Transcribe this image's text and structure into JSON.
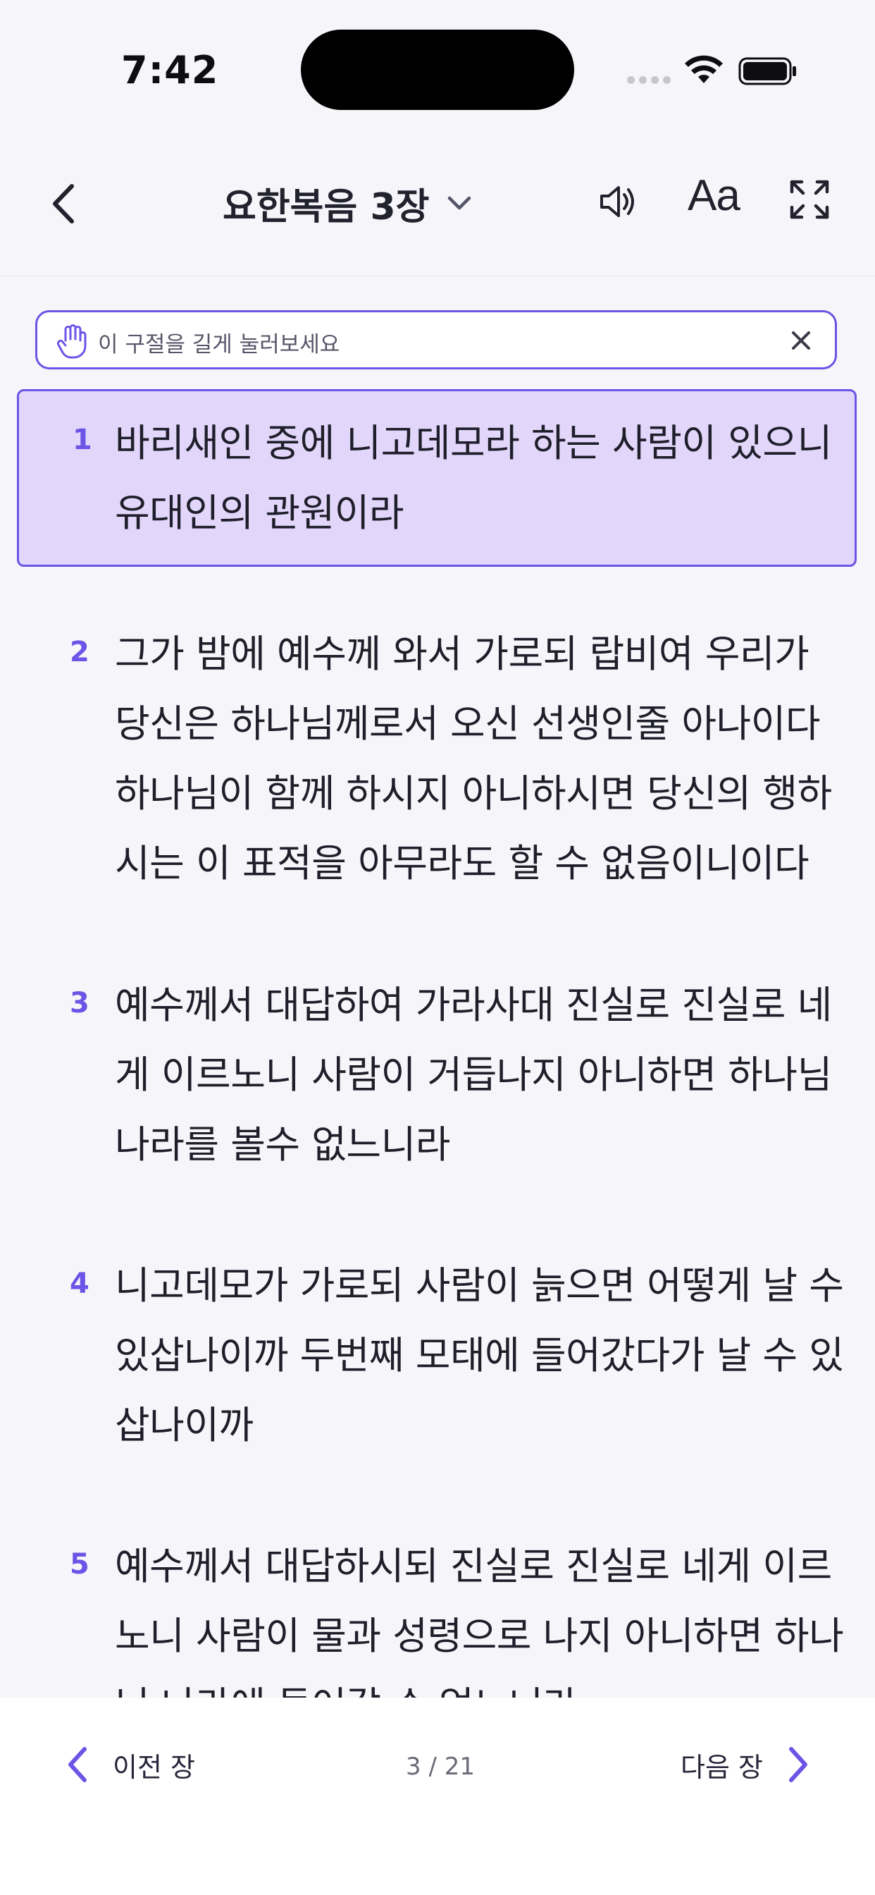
{
  "status_bar": {
    "time": "7:42"
  },
  "header": {
    "title": "요한복음 3장",
    "font_button_label": "Aa",
    "icons": [
      "back-chevron-icon",
      "chevron-down-icon",
      "speaker-icon",
      "expand-icon"
    ]
  },
  "tip": {
    "text": "이 구절을 길게 눌러보세요",
    "icons": [
      "hand-icon",
      "close-icon"
    ]
  },
  "verses": [
    {
      "number": "1",
      "text": "바리새인 중에 니고데모라 하는 사람이 있으니 유대인의 관원이라",
      "highlighted": true
    },
    {
      "number": "2",
      "text": "그가 밤에 예수께 와서 가로되 랍비여 우리가 당신은 하나님께로서 오신 선생인줄 아나이다 하나님이 함께 하시지 아니하시면 당신의 행하시는 이 표적을 아무라도 할 수 없음이니이다",
      "highlighted": false
    },
    {
      "number": "3",
      "text": "예수께서 대답하여 가라사대 진실로 진실로 네게 이르노니 사람이 거듭나지 아니하면 하나님 나라를 볼수 없느니라",
      "highlighted": false
    },
    {
      "number": "4",
      "text": "니고데모가 가로되 사람이 늙으면 어떻게 날 수 있삽나이까 두번째 모태에 들어갔다가 날 수 있삽나이까",
      "highlighted": false
    },
    {
      "number": "5",
      "text": "예수께서 대답하시되 진실로 진실로 네게 이르노니 사람이 물과 성령으로 나지 아니하면 하나님 나라에 들어갈 수 없느니라",
      "highlighted": false
    }
  ],
  "bottom_nav": {
    "prev_label": "이전 장",
    "page_indicator": "3 / 21",
    "next_label": "다음 장"
  },
  "colors": {
    "accent": "#6b54e6",
    "highlight_bg": "#e2d7fb",
    "background": "#f6f6fa"
  }
}
